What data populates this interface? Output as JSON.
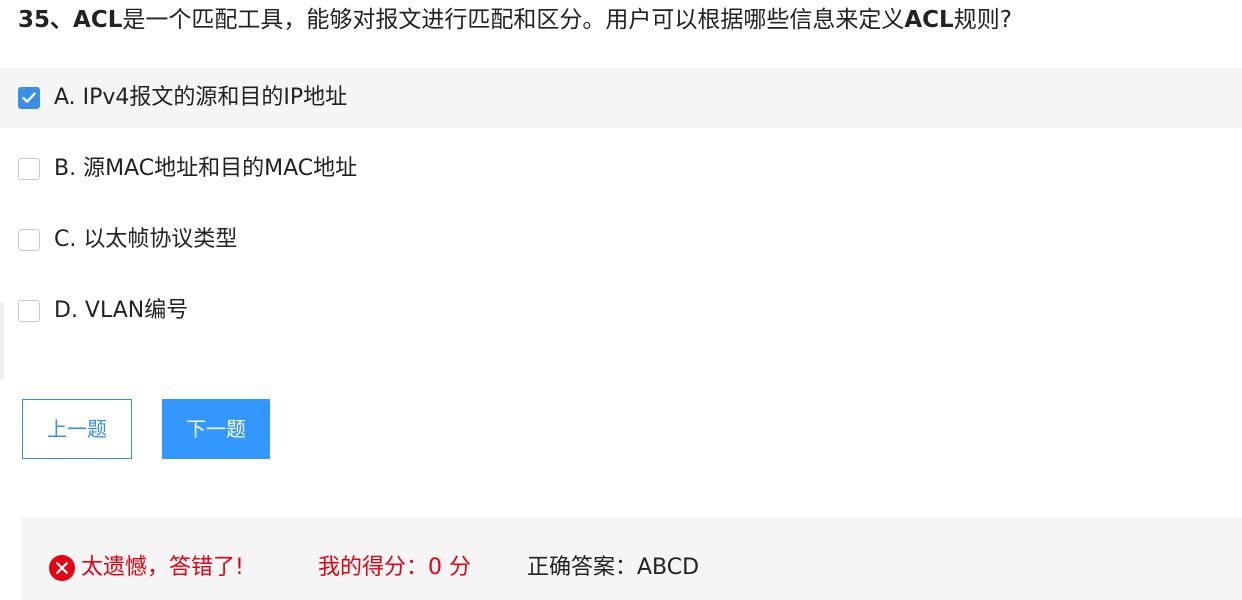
{
  "question": {
    "number": "35、",
    "text_bold_1": "ACL",
    "text_1": "是一个匹配工具，能够对报文进行匹配和区分。用户可以根据哪些信息来定义",
    "text_bold_2": "ACL",
    "text_2": "规则?"
  },
  "options": [
    {
      "label": "A. IPv4报文的源和目的IP地址",
      "checked": true
    },
    {
      "label": "B. 源MAC地址和目的MAC地址",
      "checked": false
    },
    {
      "label": "C. 以太帧协议类型",
      "checked": false
    },
    {
      "label": "D. VLAN编号",
      "checked": false
    }
  ],
  "buttons": {
    "prev_label": "上一题",
    "next_label": "下一题"
  },
  "result": {
    "status_text": "太遗憾，答错了!",
    "score_text": "我的得分：0 分",
    "answer_text": "正确答案：ABCD"
  },
  "colors": {
    "accent": "#3a8ee6",
    "button_primary": "#3398fd",
    "error": "#e60012",
    "selected_row_bg": "#f5f5f5"
  },
  "icons": {
    "check": "checkmark-icon",
    "wrong": "error-x-circle-icon"
  }
}
